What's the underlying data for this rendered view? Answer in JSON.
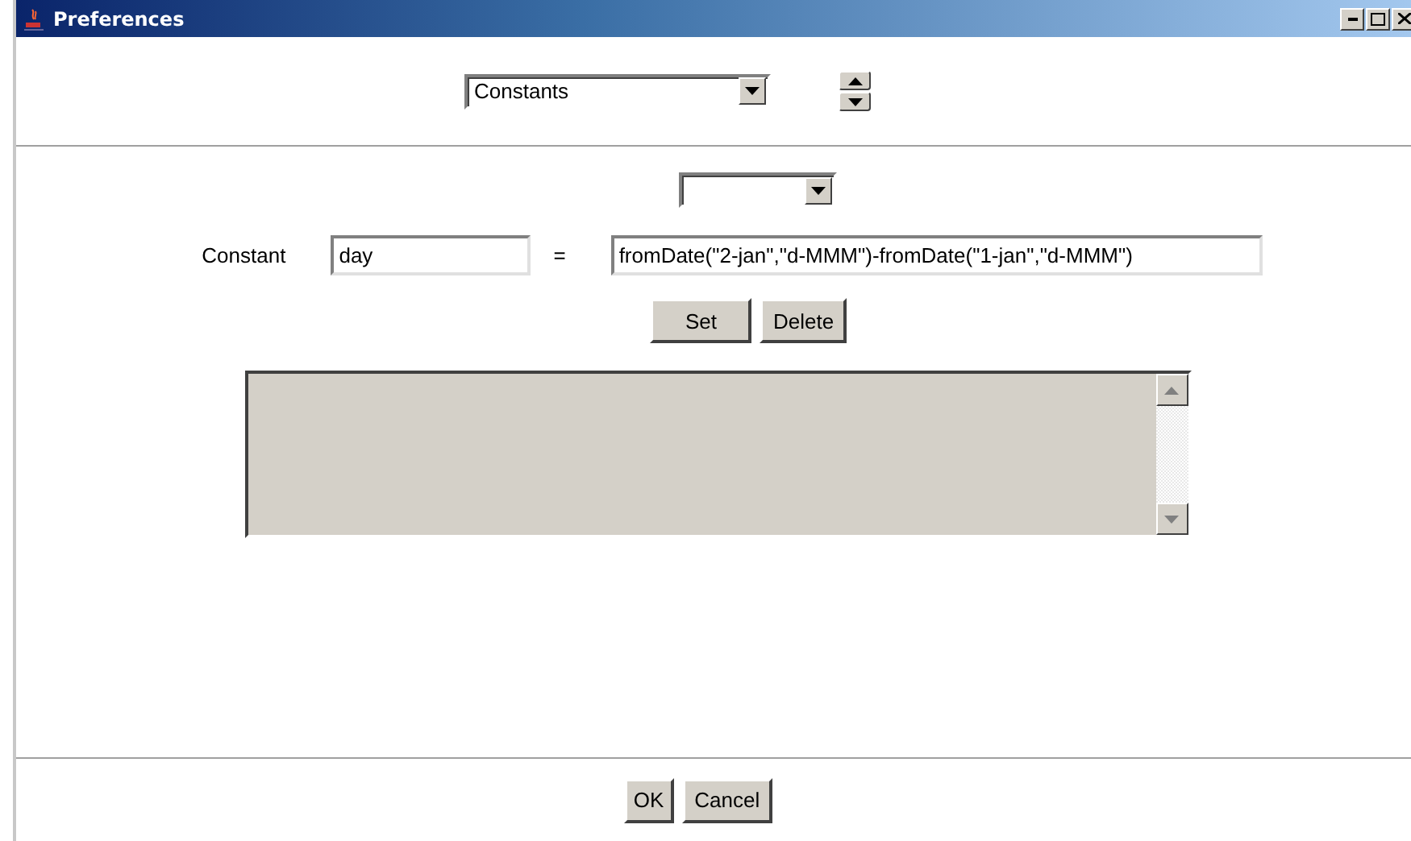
{
  "window": {
    "title": "Preferences"
  },
  "category_select": {
    "value": "Constants"
  },
  "constant_form": {
    "label": "Constant",
    "name": "day",
    "equals": "=",
    "expression": "fromDate(\"2-jan\",\"d-MMM\")-fromDate(\"1-jan\",\"d-MMM\")"
  },
  "form_buttons": [
    "Set",
    "Delete"
  ],
  "dialog_buttons": [
    "OK",
    "Cancel"
  ]
}
